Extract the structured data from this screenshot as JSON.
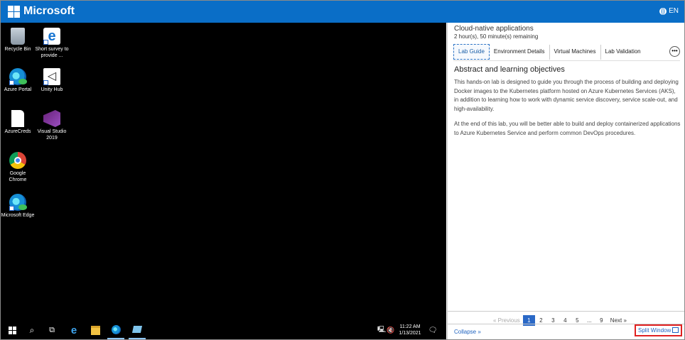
{
  "brand": {
    "name": "Microsoft",
    "lang": "EN",
    "colors": {
      "topbar": "#0a6ec7",
      "desktop": "#000000",
      "accent": "#2a68c6",
      "highlight": "#e02020"
    }
  },
  "desktop": {
    "icons": [
      {
        "label": "Recycle Bin",
        "icon": "recycle-bin-icon"
      },
      {
        "label": "Short survey to provide ...",
        "icon": "internet-explorer-icon"
      },
      {
        "label": "Azure Portal",
        "icon": "edge-icon"
      },
      {
        "label": "Unity Hub",
        "icon": "unity-hub-icon"
      },
      {
        "label": "AzureCreds",
        "icon": "text-document-icon"
      },
      {
        "label": "Visual Studio 2019",
        "icon": "visual-studio-icon"
      },
      {
        "label": "Google Chrome",
        "icon": "chrome-icon"
      },
      {
        "label": "Microsoft Edge",
        "icon": "edge-icon"
      }
    ]
  },
  "taskbar": {
    "items": [
      "start-icon",
      "search-icon",
      "task-view-icon",
      "internet-explorer-icon",
      "file-explorer-icon",
      "edge-icon",
      "azure-app-icon"
    ],
    "tray": [
      "network-icon",
      "volume-muted-icon",
      "notifications-icon"
    ],
    "time": "11:22 AM",
    "date": "1/13/2021"
  },
  "panel": {
    "title": "Cloud-native applications",
    "remaining": "2 hour(s), 50 minute(s) remaining",
    "tabs": [
      {
        "label": "Lab Guide",
        "active": true
      },
      {
        "label": "Environment Details",
        "active": false
      },
      {
        "label": "Virtual Machines",
        "active": false
      },
      {
        "label": "Lab Validation",
        "active": false
      }
    ],
    "more": "•••",
    "heading": "Abstract and learning objectives",
    "paragraphs": [
      "This hands-on lab is designed to guide you through the process of building and deploying Docker images to the Kubernetes platform hosted on Azure Kubernetes Services (AKS), in addition to learning how to work with dynamic service discovery, service scale-out, and high-availability.",
      "At the end of this lab, you will be better able to build and deploy containerized applications to Azure Kubernetes Service and perform common DevOps procedures."
    ],
    "pagination": {
      "previous": "« Previous",
      "pages": [
        "1",
        "2",
        "3",
        "4",
        "5",
        "...",
        "9"
      ],
      "current": "1",
      "next": "Next »"
    },
    "collapse": "Collapse »",
    "split_window": "Split Window"
  }
}
